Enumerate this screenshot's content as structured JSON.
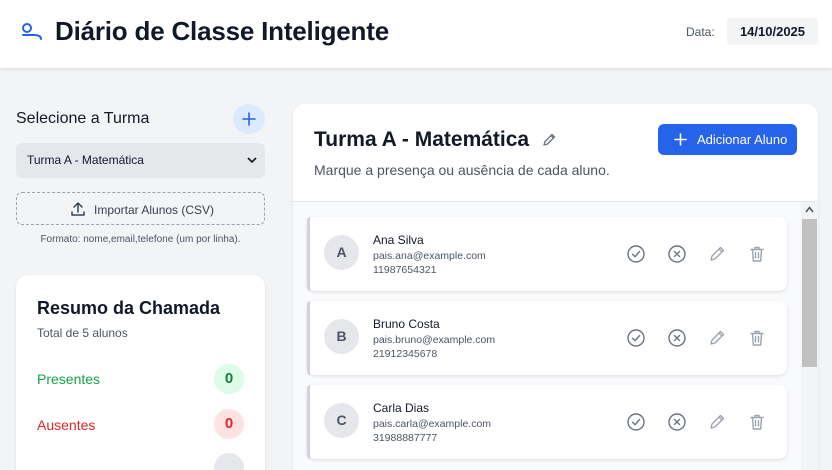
{
  "header": {
    "app_title": "Diário de Classe Inteligente",
    "date_label": "Data:",
    "date_value": "14/10/2025"
  },
  "sidebar": {
    "select_label": "Selecione a Turma",
    "selected_class": "Turma A - Matemática",
    "import_label": "Importar Alunos (CSV)",
    "format_hint": "Formato: nome,email,telefone (um por linha)."
  },
  "summary": {
    "title": "Resumo da Chamada",
    "subtitle": "Total de 5 alunos",
    "present_label": "Presentes",
    "present_count": "0",
    "absent_label": "Ausentes",
    "absent_count": "0"
  },
  "main": {
    "class_title": "Turma A - Matemática",
    "subtitle": "Marque a presença ou ausência de cada aluno.",
    "add_student_label": "Adicionar Aluno"
  },
  "students": [
    {
      "initial": "A",
      "name": "Ana Silva",
      "email": "pais.ana@example.com",
      "phone": "11987654321"
    },
    {
      "initial": "B",
      "name": "Bruno Costa",
      "email": "pais.bruno@example.com",
      "phone": "21912345678"
    },
    {
      "initial": "C",
      "name": "Carla Dias",
      "email": "pais.carla@example.com",
      "phone": "31988887777"
    }
  ],
  "icons": {
    "logo": "key-icon",
    "add_class": "plus-icon",
    "import": "upload-icon",
    "present": "check-circle-icon",
    "absent": "x-circle-icon",
    "edit": "pencil-icon",
    "delete": "trash-icon"
  },
  "colors": {
    "primary": "#2563eb",
    "present": "#16a34a",
    "absent": "#dc2626"
  }
}
